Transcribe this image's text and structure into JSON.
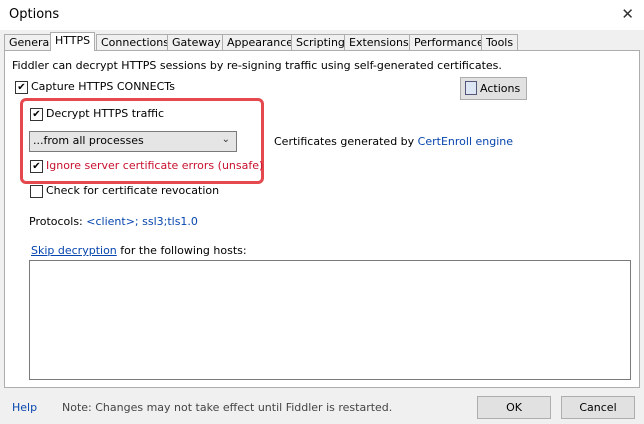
{
  "window": {
    "title": "Options",
    "close_glyph": "✕"
  },
  "tabs": [
    {
      "label": "General"
    },
    {
      "label": "HTTPS",
      "active": true
    },
    {
      "label": "Connections"
    },
    {
      "label": "Gateway"
    },
    {
      "label": "Appearance"
    },
    {
      "label": "Scripting"
    },
    {
      "label": "Extensions"
    },
    {
      "label": "Performance"
    },
    {
      "label": "Tools"
    }
  ],
  "https": {
    "intro": "Fiddler can decrypt HTTPS sessions by re-signing traffic using self-generated certificates.",
    "capture_connects": {
      "label": "Capture HTTPS CONNECTs",
      "checked": true
    },
    "decrypt_traffic": {
      "label": "Decrypt HTTPS traffic",
      "checked": true
    },
    "process_filter": {
      "selected": "...from all processes"
    },
    "ignore_cert_errors": {
      "label": "Ignore server certificate errors (unsafe)",
      "checked": true
    },
    "check_revocation": {
      "label": "Check for certificate revocation",
      "checked": false
    },
    "cert_generator_prefix": "Certificates generated by ",
    "cert_generator_link": "CertEnroll engine",
    "actions_button": "Actions",
    "protocols_label": "Protocols: ",
    "protocols_value": "<client>; ssl3;tls1.0",
    "skip_link": "Skip decryption",
    "skip_suffix": " for the following hosts:",
    "skip_hosts": ""
  },
  "footer": {
    "help": "Help",
    "note": "Note: Changes may not take effect until Fiddler is restarted.",
    "ok": "OK",
    "cancel": "Cancel"
  },
  "colors": {
    "highlight_border": "#e5484d",
    "link": "#0645ad",
    "warning_text": "#c8102e"
  },
  "icons": [
    "close-icon",
    "checkmark-icon",
    "chevron-down-icon",
    "certificate-icon"
  ]
}
